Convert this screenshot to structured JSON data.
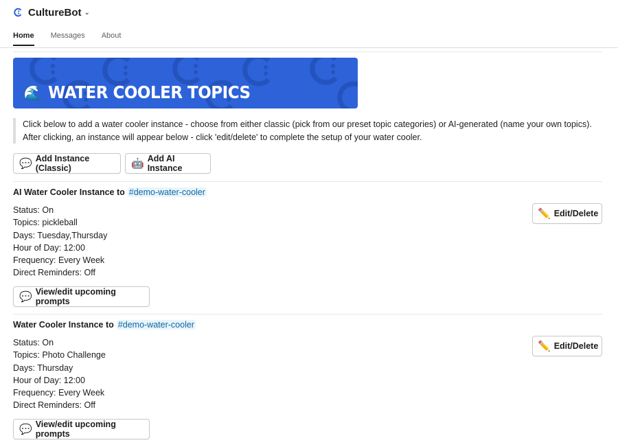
{
  "app": {
    "name": "CultureBot",
    "chevron_glyph": "⌄"
  },
  "tabs": [
    {
      "label": "Home",
      "active": true
    },
    {
      "label": "Messages",
      "active": false
    },
    {
      "label": "About",
      "active": false
    }
  ],
  "banner": {
    "emoji": "🌊",
    "title": "WATER COOLER TOPICS",
    "bg_color": "#2d62d9"
  },
  "instructions": {
    "line1": "Click below to add a water cooler instance - choose from either classic (pick from our preset topic categories) or AI-generated (name your own topics).",
    "line2": "After clicking, an instance will appear below - click 'edit/delete' to complete the setup of your water cooler."
  },
  "actions": {
    "add_classic": {
      "icon": "💬",
      "label": "Add Instance (Classic)"
    },
    "add_ai": {
      "icon": "🤖",
      "label": "Add AI Instance"
    }
  },
  "instances": [
    {
      "title_prefix": "AI Water Cooler Instance to",
      "channel": "#demo-water-cooler",
      "status": "Status: On",
      "topics": "Topics: pickleball",
      "days": "Days: Tuesday,Thursday",
      "hour": "Hour of Day: 12:00",
      "frequency": "Frequency: Every Week",
      "reminders": "Direct Reminders: Off",
      "edit_icon": "✏️",
      "edit_label": "Edit/Delete",
      "view_icon": "💬",
      "view_label": "View/edit upcoming prompts"
    },
    {
      "title_prefix": "Water Cooler Instance to",
      "channel": "#demo-water-cooler",
      "status": "Status: On",
      "topics": "Topics: Photo Challenge",
      "days": "Days: Thursday",
      "hour": "Hour of Day: 12:00",
      "frequency": "Frequency: Every Week",
      "reminders": "Direct Reminders: Off",
      "edit_icon": "✏️",
      "edit_label": "Edit/Delete",
      "view_icon": "💬",
      "view_label": "View/edit upcoming prompts"
    }
  ]
}
